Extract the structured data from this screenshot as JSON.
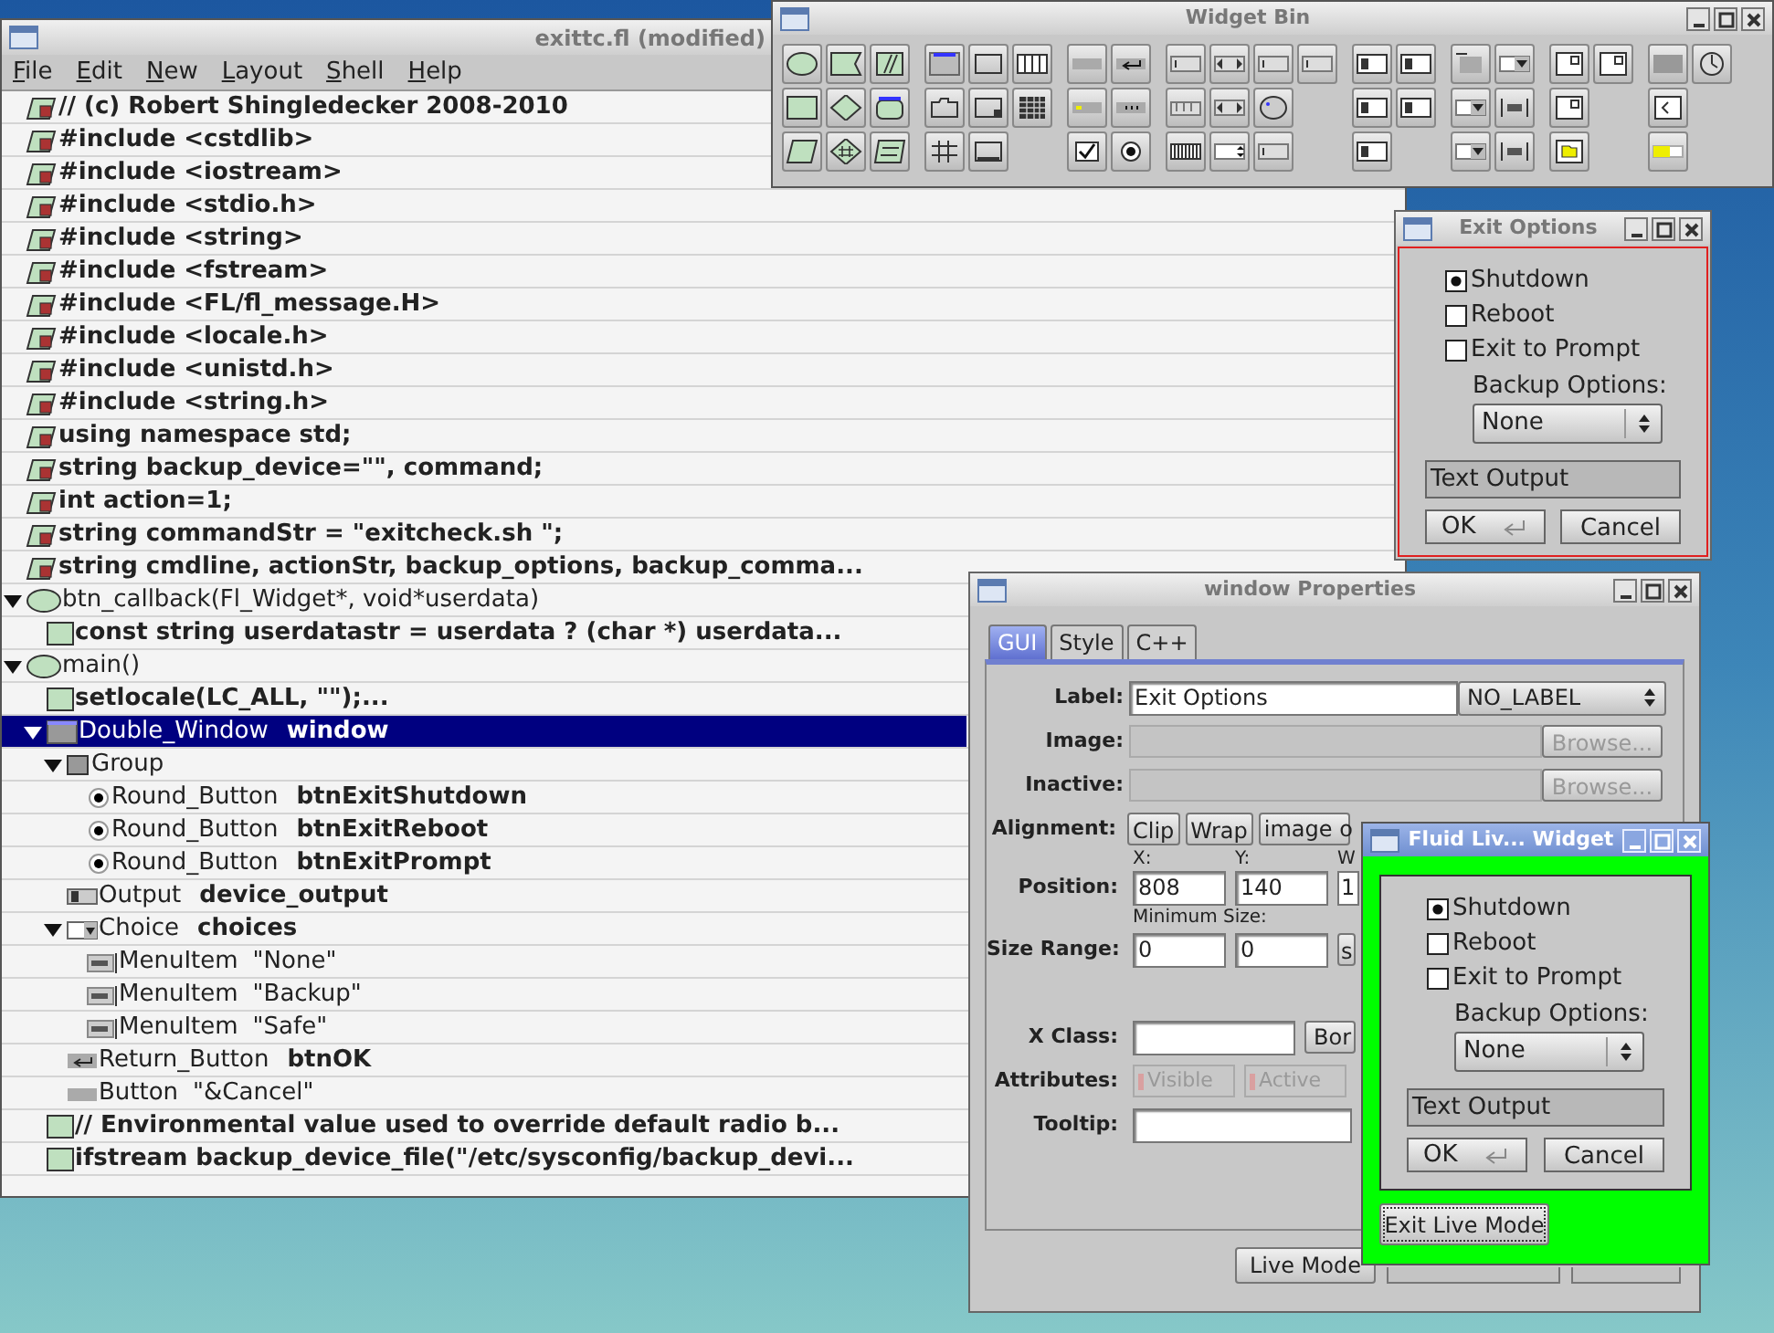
{
  "main_window": {
    "title": "exittc.fl (modified)",
    "menu": [
      "File",
      "Edit",
      "New",
      "Layout",
      "Shell",
      "Help"
    ],
    "tree": [
      {
        "kind": "decl",
        "text": "// (c) Robert Shingledecker 2008-2010",
        "selected": false
      },
      {
        "kind": "decl",
        "text": "#include <cstdlib>",
        "selected": false
      },
      {
        "kind": "decl",
        "text": "#include <iostream>",
        "selected": false
      },
      {
        "kind": "decl",
        "text": "#include <stdio.h>",
        "selected": false
      },
      {
        "kind": "decl",
        "text": "#include <string>",
        "selected": false
      },
      {
        "kind": "decl",
        "text": "#include <fstream>",
        "selected": false
      },
      {
        "kind": "decl",
        "text": "#include <FL/fl_message.H>",
        "selected": false
      },
      {
        "kind": "decl",
        "text": "#include <locale.h>",
        "selected": false
      },
      {
        "kind": "decl",
        "text": "#include <unistd.h>",
        "selected": false
      },
      {
        "kind": "decl",
        "text": "#include <string.h>",
        "selected": false
      },
      {
        "kind": "decl",
        "text": "using namespace std;",
        "selected": false
      },
      {
        "kind": "decl",
        "text": "string backup_device=\"\", command;",
        "selected": false
      },
      {
        "kind": "decl",
        "text": "int action=1;",
        "selected": false
      },
      {
        "kind": "decl",
        "text": "string commandStr = \"exitcheck.sh \";",
        "selected": false
      },
      {
        "kind": "decl",
        "text": "string cmdline, actionStr, backup_options, backup_comma...",
        "selected": false
      },
      {
        "kind": "function",
        "text": "btn_callback(Fl_Widget*, void*userdata)",
        "selected": false,
        "expanded": true,
        "children": [
          {
            "kind": "code",
            "text": "const string userdatastr = userdata ? (char *) userdata...",
            "selected": false
          }
        ]
      },
      {
        "kind": "function",
        "text": "main()",
        "selected": false,
        "expanded": true,
        "children": [
          {
            "kind": "code",
            "text": "setlocale(LC_ALL, \"\");...",
            "selected": false
          },
          {
            "kind": "window",
            "type": "Double_Window",
            "name": "window",
            "selected": true,
            "expanded": true,
            "children": [
              {
                "kind": "group",
                "type": "Group",
                "selected": false,
                "expanded": true,
                "children": [
                  {
                    "kind": "round",
                    "type": "Round_Button",
                    "name": "btnExitShutdown",
                    "selected": false
                  },
                  {
                    "kind": "round",
                    "type": "Round_Button",
                    "name": "btnExitReboot",
                    "selected": false
                  },
                  {
                    "kind": "round",
                    "type": "Round_Button",
                    "name": "btnExitPrompt",
                    "selected": false
                  }
                ]
              },
              {
                "kind": "output",
                "type": "Output",
                "name": "device_output",
                "selected": false
              },
              {
                "kind": "choice",
                "type": "Choice",
                "name": "choices",
                "selected": false,
                "expanded": true,
                "children": [
                  {
                    "kind": "menuitem",
                    "type": "MenuItem",
                    "label": "\"None\"",
                    "selected": false
                  },
                  {
                    "kind": "menuitem",
                    "type": "MenuItem",
                    "label": "\"Backup\"",
                    "selected": false
                  },
                  {
                    "kind": "menuitem",
                    "type": "MenuItem",
                    "label": "\"Safe\"",
                    "selected": false
                  }
                ]
              },
              {
                "kind": "return",
                "type": "Return_Button",
                "name": "btnOK",
                "selected": false
              },
              {
                "kind": "button",
                "type": "Button",
                "label": "\"&Cancel\"",
                "selected": false
              }
            ]
          },
          {
            "kind": "code",
            "text": "// Environmental value used to override default radio b...",
            "selected": false
          },
          {
            "kind": "code",
            "text": "ifstream backup_device_file(\"/etc/sysconfig/backup_devi...",
            "selected": false
          }
        ]
      }
    ]
  },
  "widget_bin": {
    "title": "Widget Bin"
  },
  "exit_options": {
    "title": "Exit Options",
    "options": [
      {
        "label": "Shutdown",
        "checked": true
      },
      {
        "label": "Reboot",
        "checked": false
      },
      {
        "label": "Exit to Prompt",
        "checked": false
      }
    ],
    "backup_label": "Backup Options:",
    "choice": "None",
    "output": "Text Output",
    "ok": "OK",
    "cancel": "Cancel"
  },
  "properties": {
    "title": "window Properties",
    "tabs": [
      {
        "label": "GUI",
        "selected": true
      },
      {
        "label": "Style",
        "selected": false
      },
      {
        "label": "C++",
        "selected": false
      }
    ],
    "label_label": "Label:",
    "label_value": "Exit Options",
    "label_type": "NO_LABEL",
    "image_label": "Image:",
    "inactive_label": "Inactive:",
    "browse": "Browse...",
    "browse_2": "Browse...",
    "alignment_label": "Alignment:",
    "clip": "Clip",
    "wrap": "Wrap",
    "image_choice": "image o",
    "x_label": "X:",
    "y_label": "Y:",
    "w_label": "W",
    "position_label": "Position:",
    "x_value": "808",
    "y_value": "140",
    "w_value": "1",
    "min_size_label": "Minimum Size:",
    "size_range_label": "Size Range:",
    "min_w": "0",
    "min_h": "0",
    "set_button": "s",
    "xclass_label": "X Class:",
    "border_button": "Bor",
    "attributes_label": "Attributes:",
    "visible": "Visible",
    "active": "Active",
    "tooltip_label": "Tooltip:",
    "live_mode": "Live Mode"
  },
  "live_widget": {
    "title": "Fluid Liv... Widget",
    "options": [
      {
        "label": "Shutdown",
        "checked": true
      },
      {
        "label": "Reboot",
        "checked": false
      },
      {
        "label": "Exit to Prompt",
        "checked": false
      }
    ],
    "backup_label": "Backup Options:",
    "choice": "None",
    "output": "Text Output",
    "ok": "OK",
    "cancel": "Cancel",
    "exit_button": "Exit Live Mode"
  }
}
